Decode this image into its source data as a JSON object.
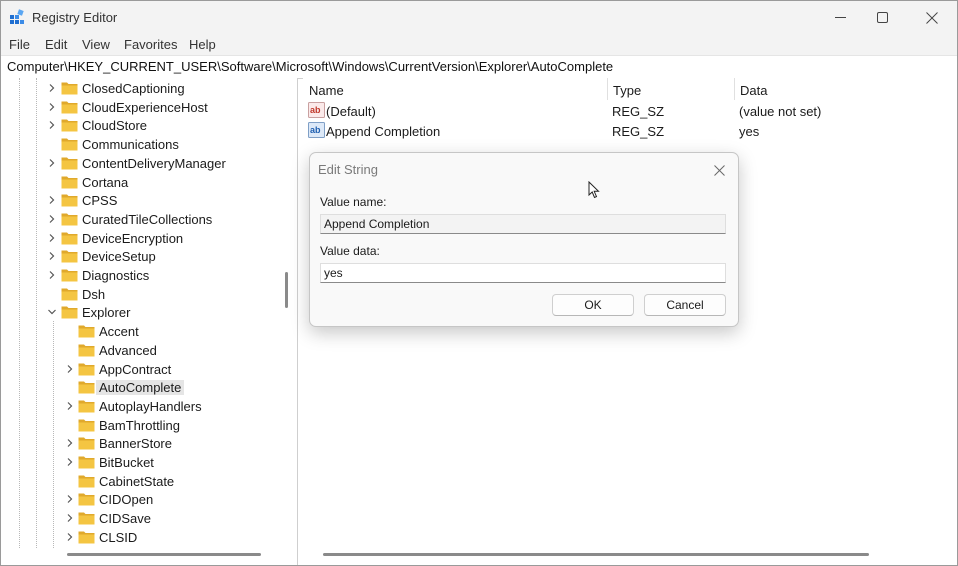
{
  "window": {
    "title": "Registry Editor"
  },
  "menu": [
    "File",
    "Edit",
    "View",
    "Favorites",
    "Help"
  ],
  "address_bar": {
    "path": "Computer\\HKEY_CURRENT_USER\\Software\\Microsoft\\Windows\\CurrentVersion\\Explorer\\AutoComplete"
  },
  "tree": {
    "items": [
      {
        "label": "ClosedCaptioning",
        "expandable": true
      },
      {
        "label": "CloudExperienceHost",
        "expandable": true
      },
      {
        "label": "CloudStore",
        "expandable": true
      },
      {
        "label": "Communications",
        "expandable": false
      },
      {
        "label": "ContentDeliveryManager",
        "expandable": true
      },
      {
        "label": "Cortana",
        "expandable": false
      },
      {
        "label": "CPSS",
        "expandable": true
      },
      {
        "label": "CuratedTileCollections",
        "expandable": true
      },
      {
        "label": "DeviceEncryption",
        "expandable": true
      },
      {
        "label": "DeviceSetup",
        "expandable": true
      },
      {
        "label": "Diagnostics",
        "expandable": true
      },
      {
        "label": "Dsh",
        "expandable": false
      },
      {
        "label": "Explorer",
        "expandable": true,
        "expanded": true
      },
      {
        "label": "Accent",
        "expandable": false,
        "child": true
      },
      {
        "label": "Advanced",
        "expandable": false,
        "child": true
      },
      {
        "label": "AppContract",
        "expandable": true,
        "child": true
      },
      {
        "label": "AutoComplete",
        "expandable": false,
        "child": true,
        "selected": true
      },
      {
        "label": "AutoplayHandlers",
        "expandable": true,
        "child": true
      },
      {
        "label": "BamThrottling",
        "expandable": false,
        "child": true
      },
      {
        "label": "BannerStore",
        "expandable": true,
        "child": true
      },
      {
        "label": "BitBucket",
        "expandable": true,
        "child": true
      },
      {
        "label": "CabinetState",
        "expandable": false,
        "child": true
      },
      {
        "label": "CIDOpen",
        "expandable": true,
        "child": true
      },
      {
        "label": "CIDSave",
        "expandable": true,
        "child": true
      },
      {
        "label": "CLSID",
        "expandable": true,
        "child": true
      }
    ]
  },
  "values_list": {
    "columns": {
      "name": "Name",
      "type": "Type",
      "data": "Data"
    },
    "rows": [
      {
        "name": "(Default)",
        "type": "REG_SZ",
        "data": "(value not set)",
        "icon": "string-value-icon"
      },
      {
        "name": "Append Completion",
        "type": "REG_SZ",
        "data": "yes",
        "icon": "binary-value-icon"
      }
    ]
  },
  "dialog": {
    "title": "Edit String",
    "value_name_label": "Value name:",
    "value_name": "Append Completion",
    "value_data_label": "Value data:",
    "value_data": "yes",
    "ok_label": "OK",
    "cancel_label": "Cancel"
  },
  "colors": {
    "folder": "#f4c542",
    "selection": "#e5e5e5",
    "titlebar": "#f3f3f3"
  }
}
